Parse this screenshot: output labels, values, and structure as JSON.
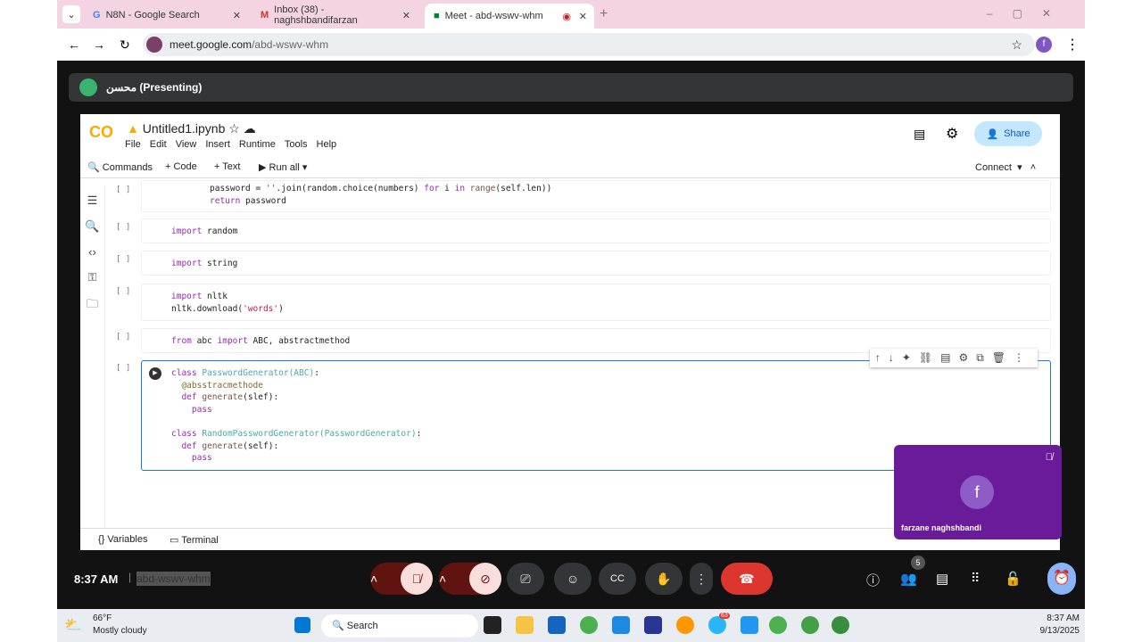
{
  "browser": {
    "tabs": [
      {
        "label": "N8N - Google Search"
      },
      {
        "label": "Inbox (38) - naghshbandifarzan"
      },
      {
        "label": "Meet - abd-wswv-whm"
      }
    ],
    "url_host": "meet.google.com",
    "url_path": "/abd-wswv-whm",
    "profile": "f"
  },
  "meet": {
    "presenter": "محسن (Presenting)",
    "time": "8:37 AM",
    "meeting_code": "abd-wswv-whm",
    "participants_count": "5",
    "self_tile_name": "farzane naghshbandi",
    "self_tile_initial": "f"
  },
  "colab": {
    "title": "Untitled1.ipynb",
    "menu": [
      "File",
      "Edit",
      "View",
      "Insert",
      "Runtime",
      "Tools",
      "Help"
    ],
    "toolbar": {
      "commands": "Commands",
      "code": "+ Code",
      "text": "+ Text",
      "run_all": "Run all",
      "connect": "Connect"
    },
    "share": "Share",
    "bottom": {
      "variables": "Variables",
      "terminal": "Terminal"
    },
    "cell_bracket": "[ ]"
  },
  "taskbar": {
    "temp": "66°F",
    "weather": "Mostly cloudy",
    "search": "Search",
    "time": "8:37 AM",
    "date": "9/13/2025",
    "badge": "63"
  }
}
